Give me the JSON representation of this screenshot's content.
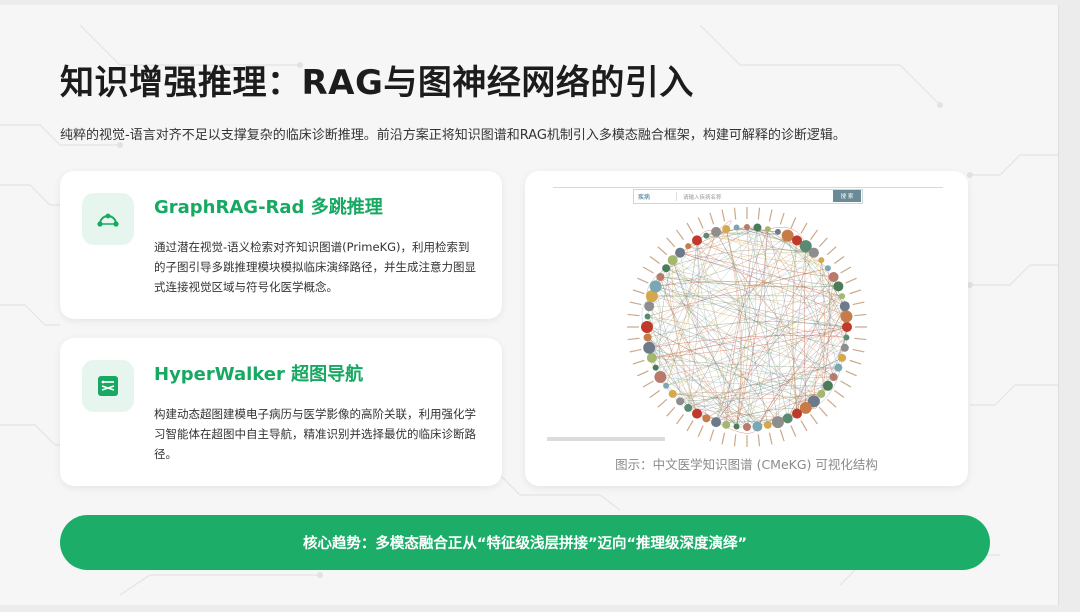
{
  "slide": {
    "title": "知识增强推理：RAG与图神经网络的引入",
    "subtitle": "纯粹的视觉-语言对齐不足以支撑复杂的临床诊断推理。前沿方案正将知识图谱和RAG机制引入多模态融合框架，构建可解释的诊断逻辑。"
  },
  "cards": [
    {
      "icon": "graph-network-icon",
      "title": "GraphRAG-Rad 多跳推理",
      "body": "通过潜在视觉-语义检索对齐知识图谱(PrimeKG)，利用检索到的子图引导多跳推理模块模拟临床演绎路径，并生成注意力图显式连接视觉区域与符号化医学概念。"
    },
    {
      "icon": "hypergraph-navigation-icon",
      "title": "HyperWalker 超图导航",
      "body": "构建动态超图建模电子病历与医学影像的高阶关联，利用强化学习智能体在超图中自主导航，精准识别并选择最优的临床诊断路径。"
    }
  ],
  "figure": {
    "search_select": "疾病",
    "search_placeholder": "请输入疾病名称",
    "search_button": "搜 索",
    "caption": "图示：中文医学知识图谱 (CMeKG) 可视化结构"
  },
  "banner": {
    "text": "核心趋势：多模态融合正从“特征级浅层拼接”迈向“推理级深度演绎”"
  },
  "colors": {
    "accent": "#1cae68",
    "accent_light": "#e6f6ee",
    "title": "#1c1c1c"
  }
}
